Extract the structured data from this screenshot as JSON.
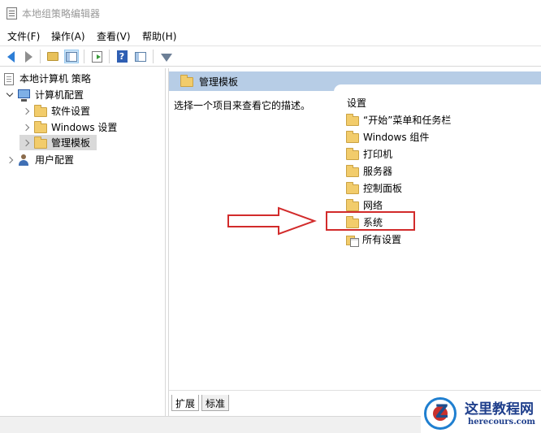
{
  "window": {
    "title": "本地组策略编辑器"
  },
  "menu": {
    "items": [
      {
        "label": "文件(F)"
      },
      {
        "label": "操作(A)"
      },
      {
        "label": "查看(V)"
      },
      {
        "label": "帮助(H)"
      }
    ]
  },
  "toolbar": {
    "buttons": [
      "back-icon",
      "forward-icon",
      "up-folder-icon",
      "show-hide-tree-icon",
      "export-list-icon",
      "help-icon",
      "show-hide-action-pane-icon",
      "filter-icon"
    ]
  },
  "tree": {
    "root": "本地计算机 策略",
    "computer_config": "计算机配置",
    "software_settings": "软件设置",
    "windows_settings": "Windows 设置",
    "admin_templates": "管理模板",
    "user_config": "用户配置"
  },
  "right_pane": {
    "header": "管理模板",
    "description": "选择一个项目来查看它的描述。",
    "column_header": "设置",
    "items": [
      {
        "label": "“开始”菜单和任务栏"
      },
      {
        "label": "Windows 组件"
      },
      {
        "label": "打印机"
      },
      {
        "label": "服务器"
      },
      {
        "label": "控制面板"
      },
      {
        "label": "网络"
      },
      {
        "label": "系统"
      },
      {
        "label": "所有设置"
      }
    ]
  },
  "tabs": [
    {
      "label": "扩展"
    },
    {
      "label": "标准"
    }
  ],
  "annotation": {
    "highlight_color": "#d22b2b",
    "highlighted_item": "系统"
  },
  "watermark": {
    "cn": "这里教程网",
    "en": "herecours.com"
  },
  "colors": {
    "header_bg": "#b7cde6",
    "selection_bg": "#d9d9d9",
    "folder": "#f2cc6b"
  }
}
